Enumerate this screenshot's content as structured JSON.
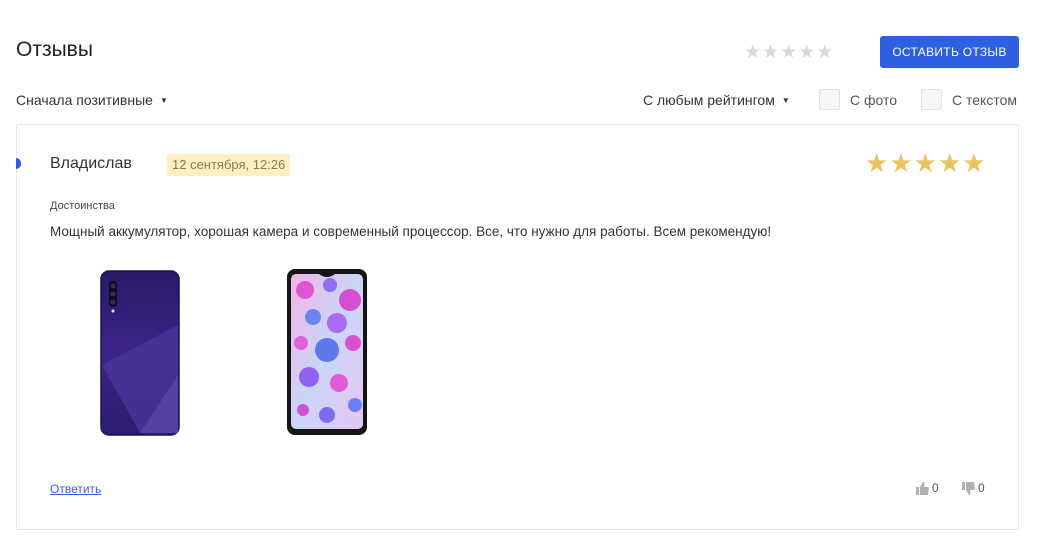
{
  "header": {
    "title": "Отзывы",
    "rating_stars": [
      "★",
      "★",
      "★",
      "★",
      "★"
    ],
    "leave_review_label": "ОСТАВИТЬ ОТЗЫВ"
  },
  "filters": {
    "sort_label": "Сначала позитивные",
    "rating_label": "С любым рейтингом",
    "with_photo_label": "С фото",
    "with_text_label": "С текстом"
  },
  "review": {
    "author": "Владислав",
    "date": "12 сентября, 12:26",
    "rating": 5,
    "stars": [
      "★",
      "★",
      "★",
      "★",
      "★"
    ],
    "section_label": "Достоинства",
    "text": "Мощный аккумулятор, хорошая камера и современный процессор. Все, что нужно для работы. Всем рекомендую!",
    "reply_label": "Ответить",
    "likes": "0",
    "dislikes": "0"
  },
  "colors": {
    "accent": "#2e5fe0",
    "star_filled": "#e9c45c",
    "star_empty": "#d9d9d9",
    "date_badge_bg": "#fdf0c4"
  },
  "icons": [
    "chevron-down-icon",
    "thumbs-up-icon",
    "thumbs-down-icon",
    "star-icon"
  ]
}
